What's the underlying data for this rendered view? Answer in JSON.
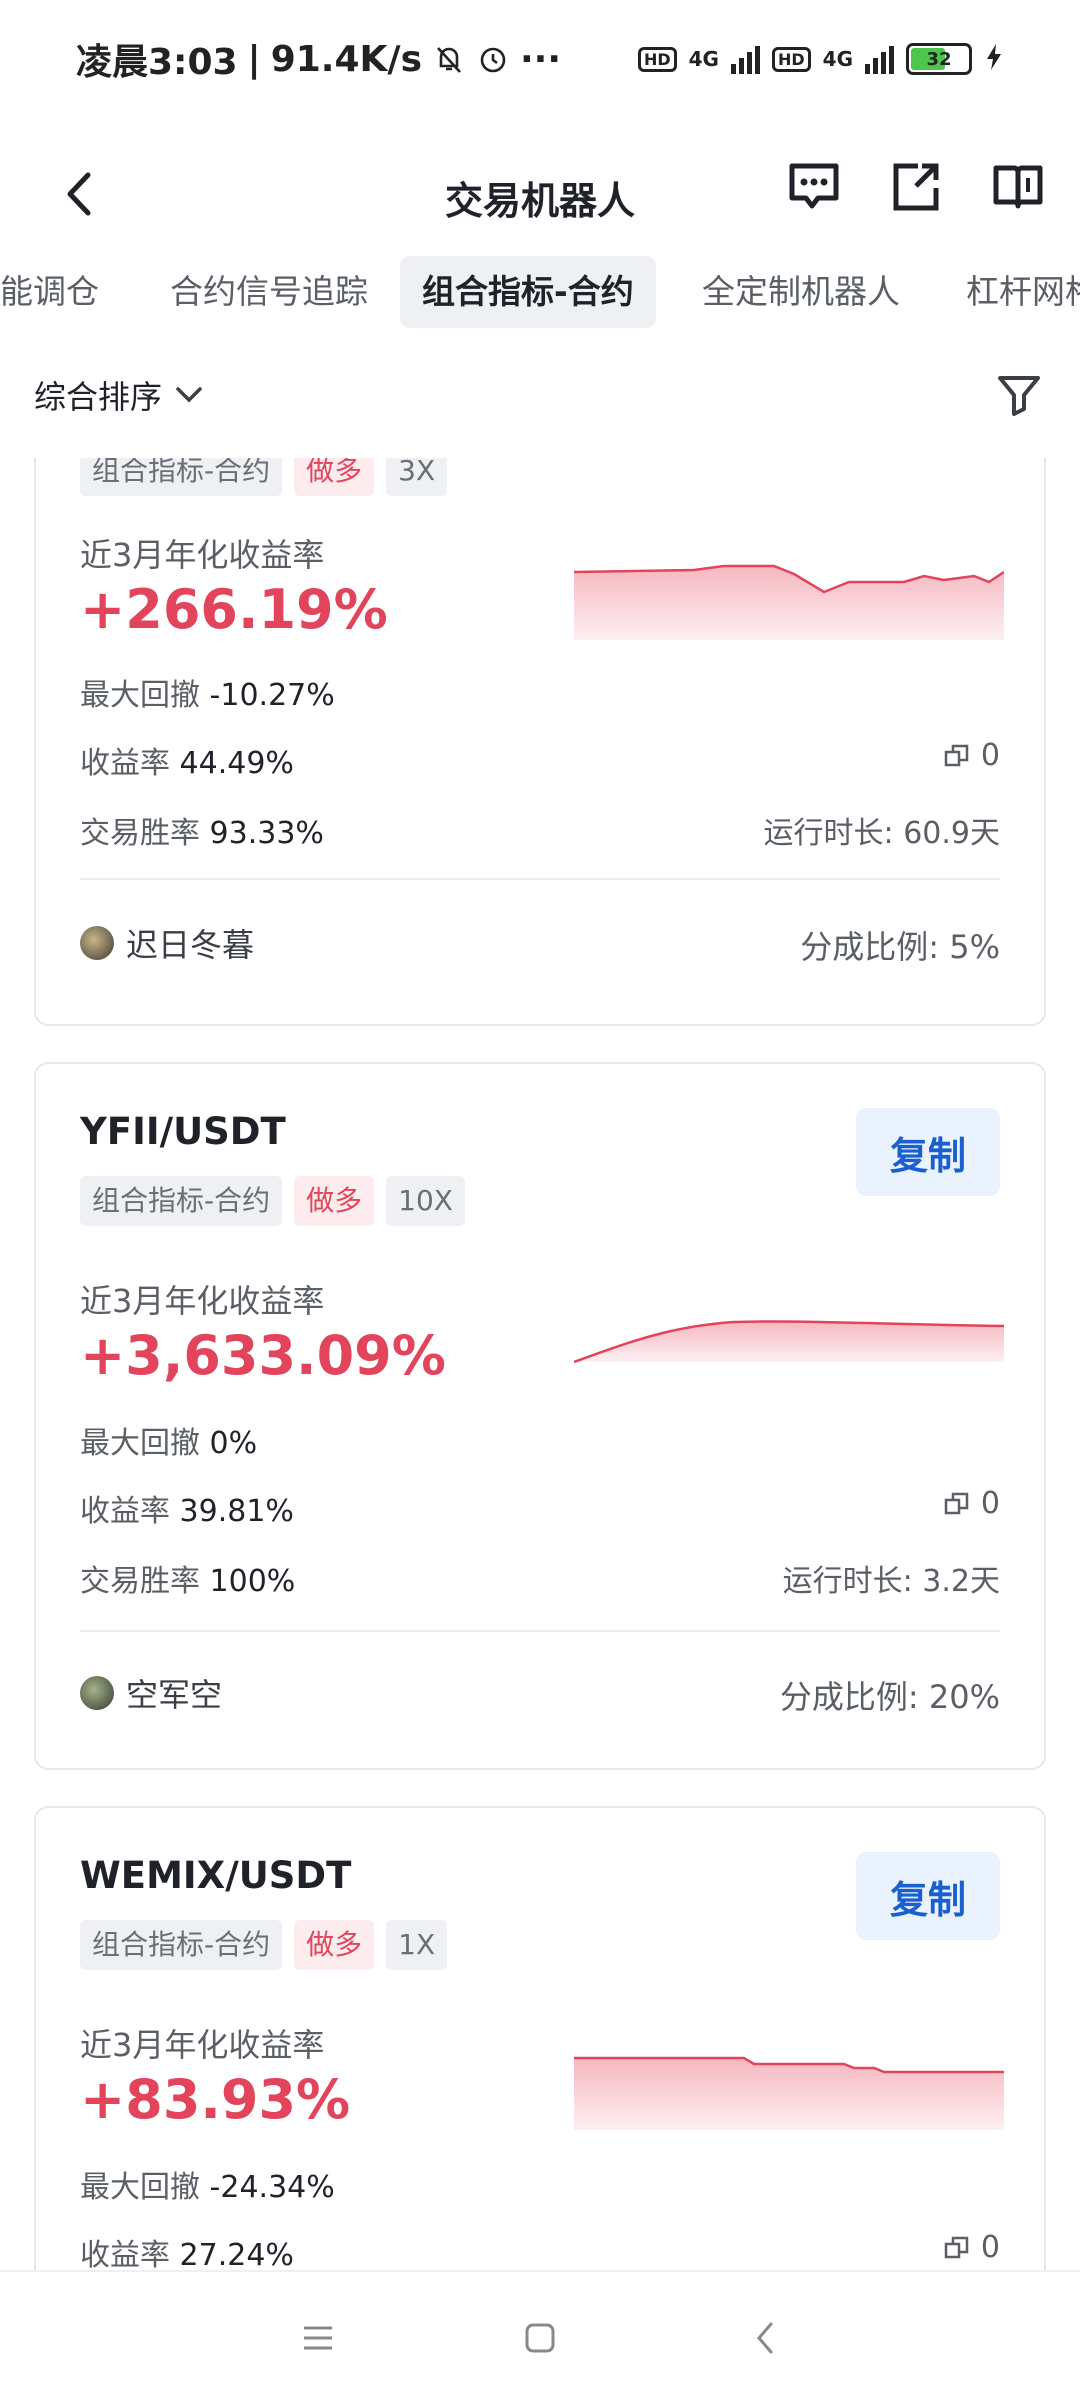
{
  "status": {
    "time": "凌晨3:03",
    "speed": "91.4K/s",
    "battery": "32",
    "network": "4G",
    "hd": "HD"
  },
  "header": {
    "title": "交易机器人"
  },
  "tabs": [
    {
      "label": "能调仓"
    },
    {
      "label": "合约信号追踪"
    },
    {
      "label": "组合指标-合约",
      "active": true
    },
    {
      "label": "全定制机器人"
    },
    {
      "label": "杠杆网格"
    }
  ],
  "sort": {
    "label": "综合排序"
  },
  "cards": [
    {
      "tags": [
        "组合指标-合约",
        "做多",
        "3X"
      ],
      "rate_label": "近3月年化收益率",
      "rate": "+266.19%",
      "drawdown_label": "最大回撤",
      "drawdown": "-10.27%",
      "yield_label": "收益率",
      "yield": "44.49%",
      "copies": "0",
      "win_label": "交易胜率",
      "win": "93.33%",
      "runtime": "运行时长: 60.9天",
      "owner": "迟日冬暮",
      "share": "分成比例: 5%"
    },
    {
      "pair": "YFII/USDT",
      "copy_label": "复制",
      "tags": [
        "组合指标-合约",
        "做多",
        "10X"
      ],
      "rate_label": "近3月年化收益率",
      "rate": "+3,633.09%",
      "drawdown_label": "最大回撤",
      "drawdown": "0%",
      "yield_label": "收益率",
      "yield": "39.81%",
      "copies": "0",
      "win_label": "交易胜率",
      "win": "100%",
      "runtime": "运行时长: 3.2天",
      "owner": "空军空",
      "share": "分成比例: 20%"
    },
    {
      "pair": "WEMIX/USDT",
      "copy_label": "复制",
      "tags": [
        "组合指标-合约",
        "做多",
        "1X"
      ],
      "rate_label": "近3月年化收益率",
      "rate": "+83.93%",
      "drawdown_label": "最大回撤",
      "drawdown": "-24.34%",
      "yield_label": "收益率",
      "yield": "27.24%",
      "copies": "0"
    }
  ],
  "colors": {
    "accent_red": "#e2445c",
    "copy_blue": "#1a5fd0"
  }
}
